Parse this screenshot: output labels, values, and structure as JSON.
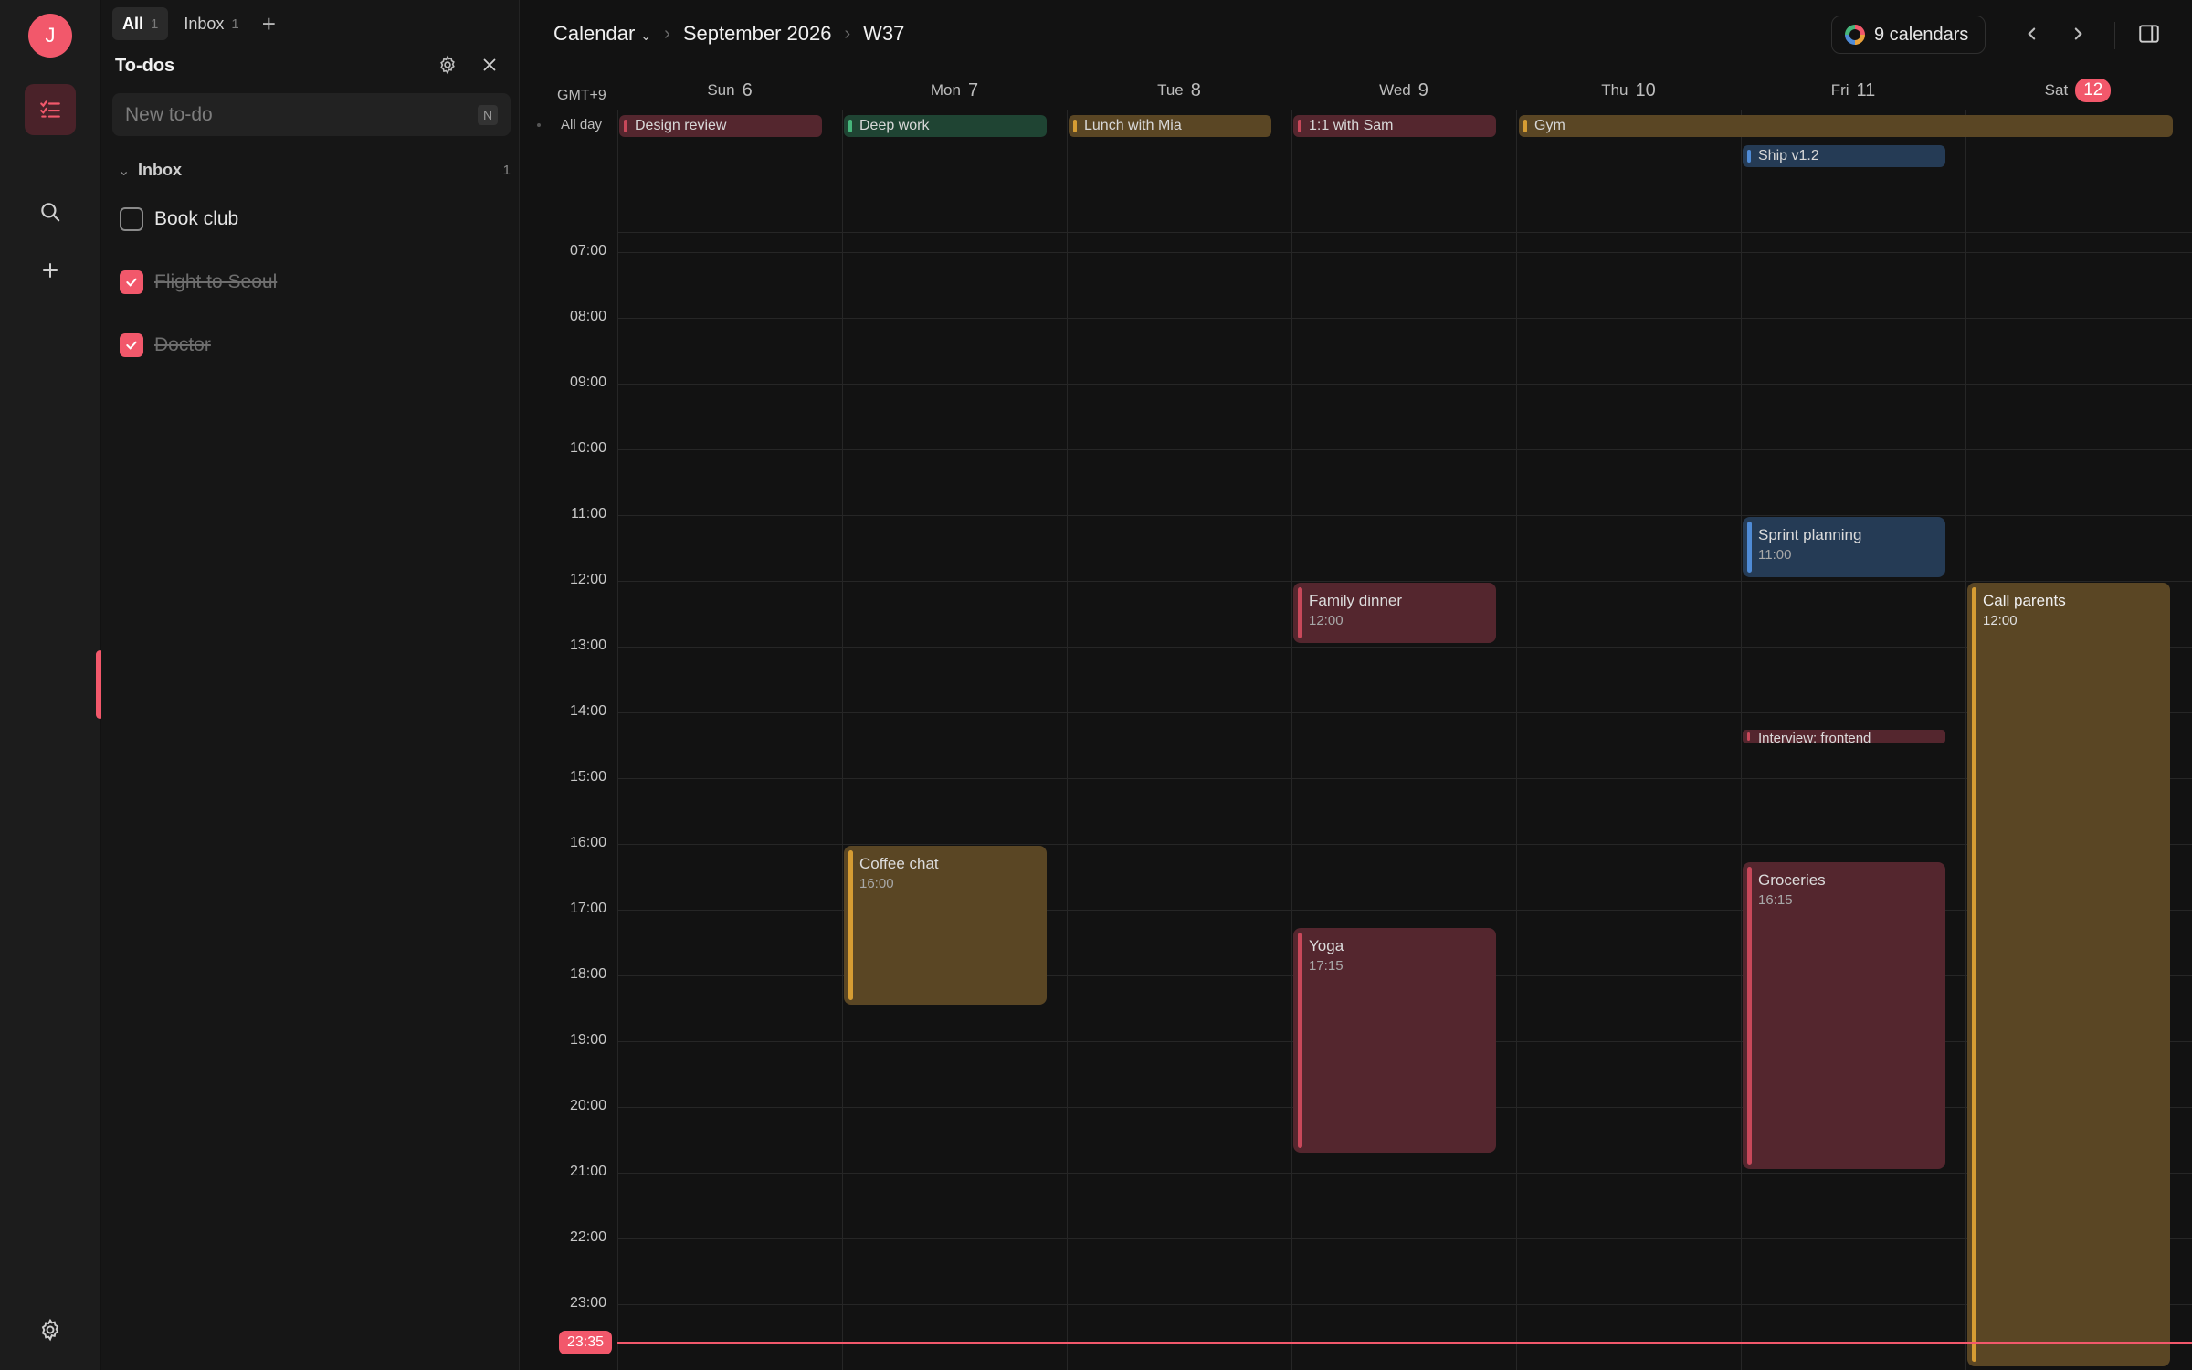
{
  "rail": {
    "avatar_initial": "J",
    "items": [
      {
        "icon": "sidebar-layout-icon"
      },
      {
        "icon": "checklist-icon",
        "active": true
      },
      {
        "icon": "search-icon"
      },
      {
        "icon": "plus-icon"
      }
    ],
    "settings_icon": "gear-icon"
  },
  "todo_panel": {
    "tabs": [
      {
        "label": "All",
        "count": "1",
        "active": true
      },
      {
        "label": "Inbox",
        "count": "1",
        "active": false
      }
    ],
    "title": "To-dos",
    "new_todo_placeholder": "New to-do",
    "new_todo_shortcut": "N",
    "section": {
      "label": "Inbox",
      "count": "1"
    },
    "items": [
      {
        "text": "Book club",
        "done": false
      },
      {
        "text": "Flight to Seoul",
        "done": true
      },
      {
        "text": "Doctor",
        "done": true
      }
    ]
  },
  "calendar": {
    "breadcrumb": {
      "view": "Calendar",
      "month": "September 2026",
      "week": "W37"
    },
    "calendars_label": "9 calendars",
    "timezone": "GMT+9",
    "allday_label": "All day",
    "days": [
      {
        "name": "Sun",
        "num": "6"
      },
      {
        "name": "Mon",
        "num": "7"
      },
      {
        "name": "Tue",
        "num": "8"
      },
      {
        "name": "Wed",
        "num": "9"
      },
      {
        "name": "Thu",
        "num": "10"
      },
      {
        "name": "Fri",
        "num": "11"
      },
      {
        "name": "Sat",
        "num": "12",
        "today": true
      }
    ],
    "hours": [
      "07:00",
      "08:00",
      "09:00",
      "10:00",
      "11:00",
      "12:00",
      "13:00",
      "14:00",
      "15:00",
      "16:00",
      "17:00",
      "18:00",
      "19:00",
      "20:00",
      "21:00",
      "22:00",
      "23:00"
    ],
    "allday_events": [
      {
        "title": "Design review",
        "day": "Sun 6",
        "color": "red"
      },
      {
        "title": "Deep work",
        "day": "Mon 7",
        "color": "green"
      },
      {
        "title": "Lunch with Mia",
        "day": "Tue 8",
        "color": "gold"
      },
      {
        "title": "1:1 with Sam",
        "day": "Wed 9",
        "color": "red"
      },
      {
        "title": "Gym",
        "day": "Thu 10 – Sat 12",
        "color": "gold"
      },
      {
        "title": "Ship v1.2",
        "day": "Fri 11",
        "color": "blue"
      }
    ],
    "events": [
      {
        "title": "Sprint planning",
        "time": "11:00",
        "day": "Fri 11",
        "color": "blue"
      },
      {
        "title": "Family dinner",
        "time": "12:00",
        "day": "Wed 9",
        "color": "red"
      },
      {
        "title": "Call parents",
        "time": "12:00",
        "day": "Sat 12",
        "color": "gold"
      },
      {
        "title": "Interview: frontend",
        "day": "Fri 11",
        "color": "red"
      },
      {
        "title": "Coffee chat",
        "time": "16:00",
        "day": "Mon 7",
        "color": "gold"
      },
      {
        "title": "Groceries",
        "time": "16:15",
        "day": "Fri 11",
        "color": "red"
      },
      {
        "title": "Yoga",
        "time": "17:15",
        "day": "Wed 9",
        "color": "red"
      }
    ],
    "now_time": "23:35",
    "colors": {
      "accent": "#f2586b",
      "red": "#54262e",
      "gold": "#5a4624",
      "blue": "#253b55",
      "green": "#1f4433"
    }
  }
}
